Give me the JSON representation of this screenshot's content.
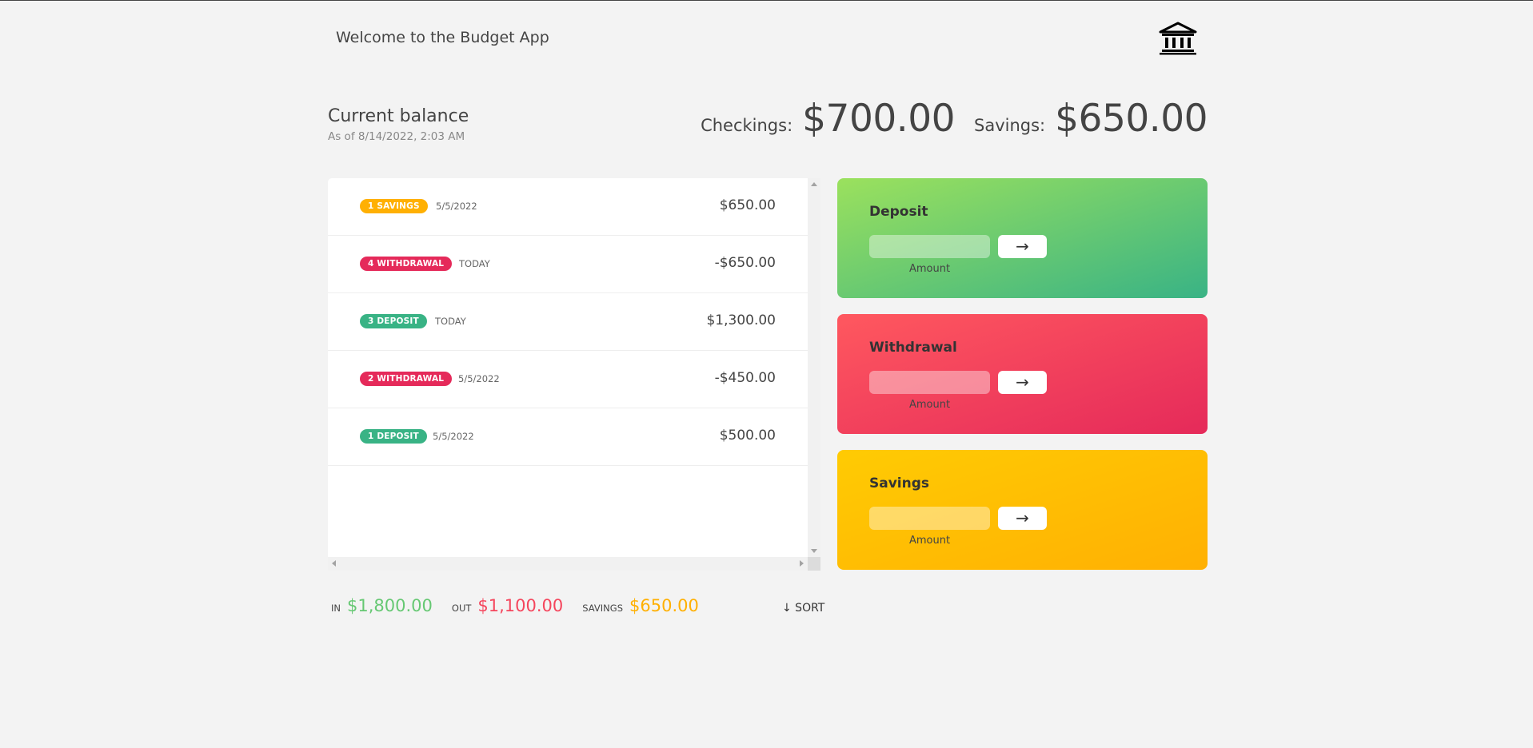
{
  "nav": {
    "welcome": "Welcome to the Budget App",
    "logo_icon": "bank-icon"
  },
  "balance": {
    "title": "Current balance",
    "date": "As of 8/14/2022, 2:03 AM",
    "checkings_label": "Checkings:",
    "checkings_value": "$700.00",
    "savings_label": "Savings:",
    "savings_value": "$650.00"
  },
  "movements": [
    {
      "type": "1 SAVINGS",
      "date": "5/5/2022",
      "value": "$650.00",
      "color": "#ffb003"
    },
    {
      "type": "4 WITHDRAWAL",
      "date": "TODAY",
      "value": "-$650.00",
      "color": "#e52a5a"
    },
    {
      "type": "3 DEPOSIT",
      "date": "TODAY",
      "value": "$1,300.00",
      "color": "#39b385"
    },
    {
      "type": "2 WITHDRAWAL",
      "date": "5/5/2022",
      "value": "-$450.00",
      "color": "#e52a5a"
    },
    {
      "type": "1 DEPOSIT",
      "date": "5/5/2022",
      "value": "$500.00",
      "color": "#39b385"
    }
  ],
  "summary": {
    "in_label": "IN",
    "in_value": "$1,800.00",
    "in_color": "#66c873",
    "out_label": "OUT",
    "out_value": "$1,100.00",
    "out_color": "#f5465d",
    "savings_label": "SAVINGS",
    "savings_value": "$650.00",
    "savings_color": "#ffb003",
    "sort_label": "↓ SORT"
  },
  "operations": {
    "deposit": {
      "title": "Deposit",
      "button": "→",
      "label": "Amount",
      "input_value": ""
    },
    "withdrawal": {
      "title": "Withdrawal",
      "button": "→",
      "label": "Amount",
      "input_value": ""
    },
    "savings": {
      "title": "Savings",
      "button": "→",
      "label": "Amount",
      "input_value": ""
    }
  }
}
